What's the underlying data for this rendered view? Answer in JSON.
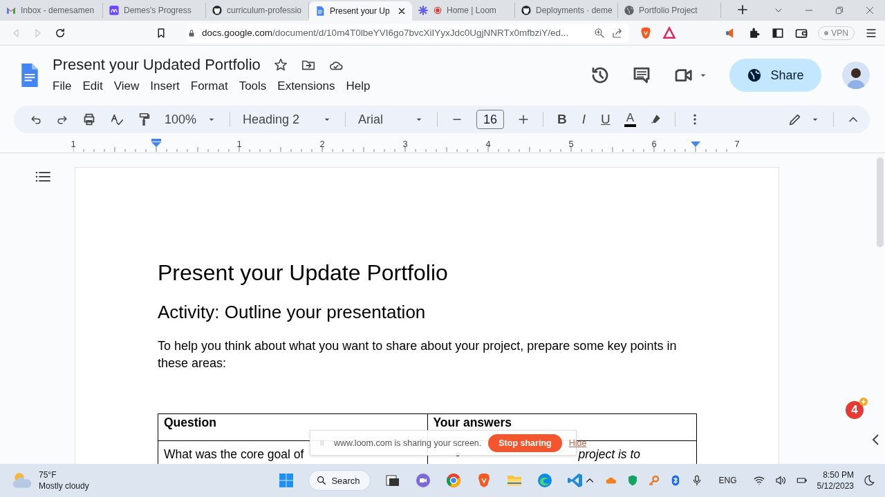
{
  "browser": {
    "tabs": [
      {
        "kind": "mail",
        "title": "Inbox - demesamen",
        "selected": false
      },
      {
        "kind": "progress",
        "title": "Demes's Progress",
        "selected": false
      },
      {
        "kind": "github",
        "title": "curriculum-professio",
        "selected": false
      },
      {
        "kind": "docs",
        "title": "Present your Up",
        "selected": true
      },
      {
        "kind": "loom",
        "title": "Home | Loom",
        "selected": false
      },
      {
        "kind": "github",
        "title": "Deployments · deme",
        "selected": false
      },
      {
        "kind": "globe",
        "title": "Portfolio Project",
        "selected": false
      }
    ],
    "url_host": "docs.google.com",
    "url_path": "/document/d/10m4T0lbeYVI6go7bvcXiIYyxJdc0UgjNNRTx0mfbziY/ed...",
    "vpn": "VPN"
  },
  "docs": {
    "title": "Present your Updated Portfolio",
    "menus": [
      "File",
      "Edit",
      "View",
      "Insert",
      "Format",
      "Tools",
      "Extensions",
      "Help"
    ],
    "share": "Share",
    "toolbar": {
      "zoom": "100%",
      "style": "Heading 2",
      "font": "Arial",
      "font_size": "16",
      "format": [
        "B",
        "I",
        "U"
      ],
      "text_color": "A"
    },
    "ruler": [
      "1",
      "1",
      "2",
      "3",
      "4",
      "5",
      "6",
      "7"
    ]
  },
  "document": {
    "title": "Present your Update Portfolio",
    "heading": "Activity: Outline your presentation",
    "paragraph": "To help you think about what you want to share about your project, prepare some key points in these areas:",
    "table": {
      "columns": [
        "Question",
        "Your answers"
      ],
      "rows": [
        [
          "What was the core goal of",
          "project is to"
        ]
      ]
    }
  },
  "notification_badge": "4",
  "loom_bar": {
    "message": "www.loom.com is sharing your screen.",
    "stop": "Stop sharing",
    "hide": "Hide"
  },
  "taskbar": {
    "temperature": "75°F",
    "condition": "Mostly cloudy",
    "search": "Search",
    "language": "ENG",
    "time": "8:50 PM",
    "date": "5/12/2023"
  }
}
